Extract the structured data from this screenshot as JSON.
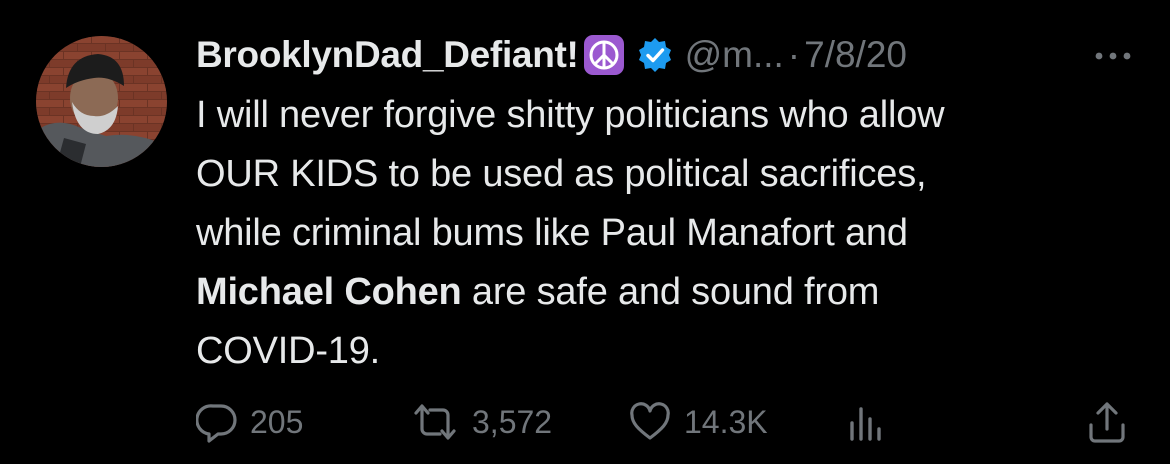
{
  "tweet": {
    "display_name": "BrooklynDad_Defiant!",
    "name_emoji": "peace-symbol",
    "verified": true,
    "handle": "@m...",
    "separator": "·",
    "date": "7/8/20",
    "body": {
      "line1": "I will never forgive shitty politicians who allow",
      "line2": "OUR KIDS to be used as political sacrifices,",
      "line3": "while criminal bums like Paul Manafort and",
      "line4_bold": "Michael Cohen",
      "line4_rest": " are safe and sound from",
      "line5": "COVID-19."
    },
    "actions": {
      "replies": "205",
      "retweets": "3,572",
      "likes": "14.3K"
    }
  },
  "colors": {
    "background": "#000000",
    "text_primary": "#e7e9ea",
    "text_secondary": "#71767b",
    "verified_badge": "#1d9bf0",
    "peace_emoji_bg": "#9b59d0"
  },
  "icons": [
    "more-icon",
    "verified-badge-icon",
    "peace-emoji-icon",
    "reply-icon",
    "retweet-icon",
    "like-icon",
    "views-icon",
    "share-icon"
  ]
}
